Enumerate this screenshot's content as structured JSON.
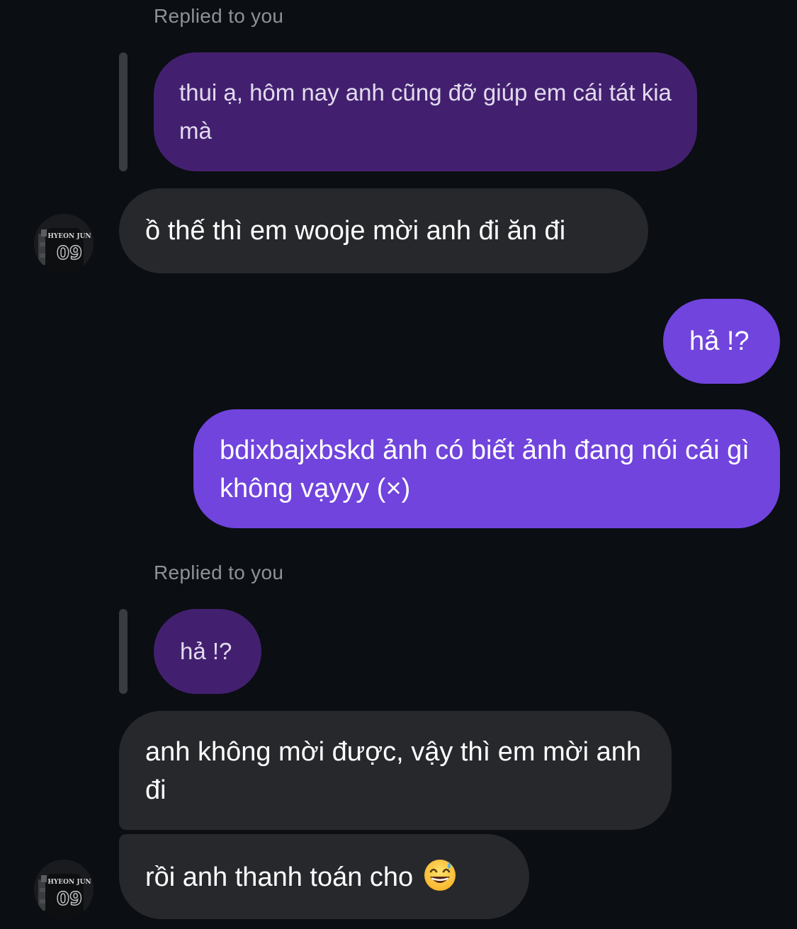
{
  "messages": [
    {
      "type": "reply-context",
      "label": "Replied to you",
      "quoted_text": "thui ạ, hôm nay anh cũng đỡ giúp em cái tát kia mà"
    },
    {
      "type": "incoming",
      "text": "ồ thế thì em wooje mời anh đi ăn đi"
    },
    {
      "type": "outgoing",
      "text": "hả !?"
    },
    {
      "type": "outgoing",
      "text": "bdixbajxbskd ảnh có biết ảnh đang nói cái gì không vạyyy (×)"
    },
    {
      "type": "reply-context",
      "label": "Replied to you",
      "quoted_text": "hả !?"
    },
    {
      "type": "incoming",
      "text": "anh không mời được, vậy thì em mời anh đi"
    },
    {
      "type": "incoming",
      "text": "rồi anh thanh toán cho",
      "emoji": "grinning-sweat-emoji"
    }
  ],
  "avatar": {
    "jersey_name": "HYEON JUN",
    "jersey_number": "09"
  },
  "colors": {
    "background": "#0b0e12",
    "incoming_bubble": "#26282c",
    "outgoing_bubble": "#7044dd",
    "quoted_bubble": "#43206f",
    "reply_label": "#8e9196"
  }
}
